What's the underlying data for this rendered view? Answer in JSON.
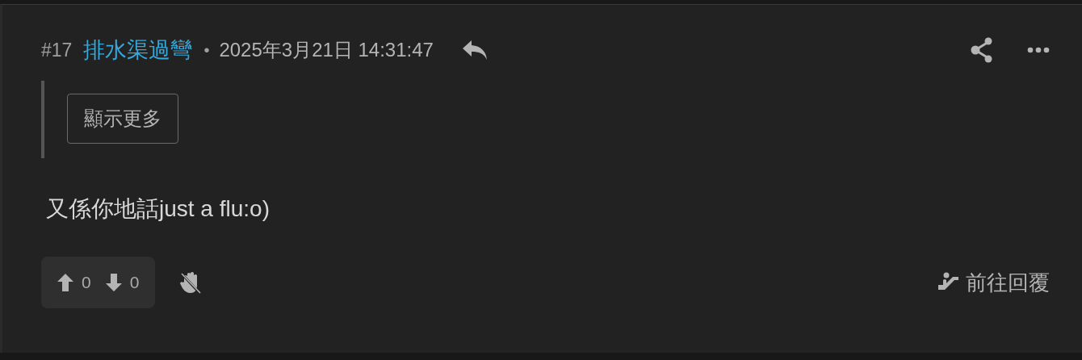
{
  "post": {
    "number": "#17",
    "author": "排水渠過彎",
    "separator": "•",
    "timestamp": "2025年3月21日 14:31:47"
  },
  "quote": {
    "button": "顯示更多"
  },
  "body": "又係你地話just a flu:o)",
  "votes": {
    "up": "0",
    "down": "0"
  },
  "goto_reply": "前往回覆"
}
